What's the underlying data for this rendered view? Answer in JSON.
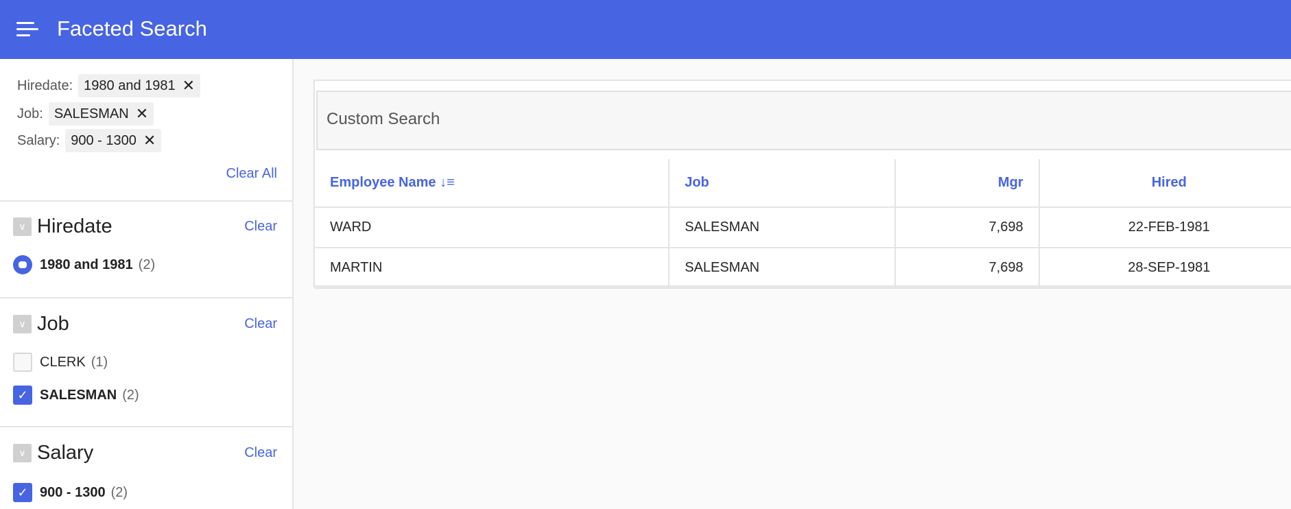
{
  "header": {
    "title": "Faceted Search"
  },
  "active_filters": [
    {
      "label": "Hiredate:",
      "value": "1980 and 1981"
    },
    {
      "label": "Job:",
      "value": "SALESMAN"
    },
    {
      "label": "Salary:",
      "value": "900 - 1300"
    }
  ],
  "clear_all": "Clear All",
  "facets": [
    {
      "title": "Hiredate",
      "clear": "Clear",
      "options": [
        {
          "label": "1980 and 1981",
          "count": "(2)",
          "selected": true
        }
      ]
    },
    {
      "title": "Job",
      "clear": "Clear",
      "options": [
        {
          "label": "CLERK",
          "count": "(1)",
          "selected": false
        },
        {
          "label": "SALESMAN",
          "count": "(2)",
          "selected": true
        }
      ]
    },
    {
      "title": "Salary",
      "clear": "Clear",
      "options": [
        {
          "label": "900 - 1300",
          "count": "(2)",
          "selected": true
        }
      ]
    }
  ],
  "search": {
    "title": "Custom Search"
  },
  "table": {
    "columns": [
      "Employee Name",
      "Job",
      "Mgr",
      "Hired"
    ],
    "rows": [
      [
        "WARD",
        "SALESMAN",
        "7,698",
        "22-FEB-1981"
      ],
      [
        "MARTIN",
        "SALESMAN",
        "7,698",
        "28-SEP-1981"
      ]
    ]
  }
}
